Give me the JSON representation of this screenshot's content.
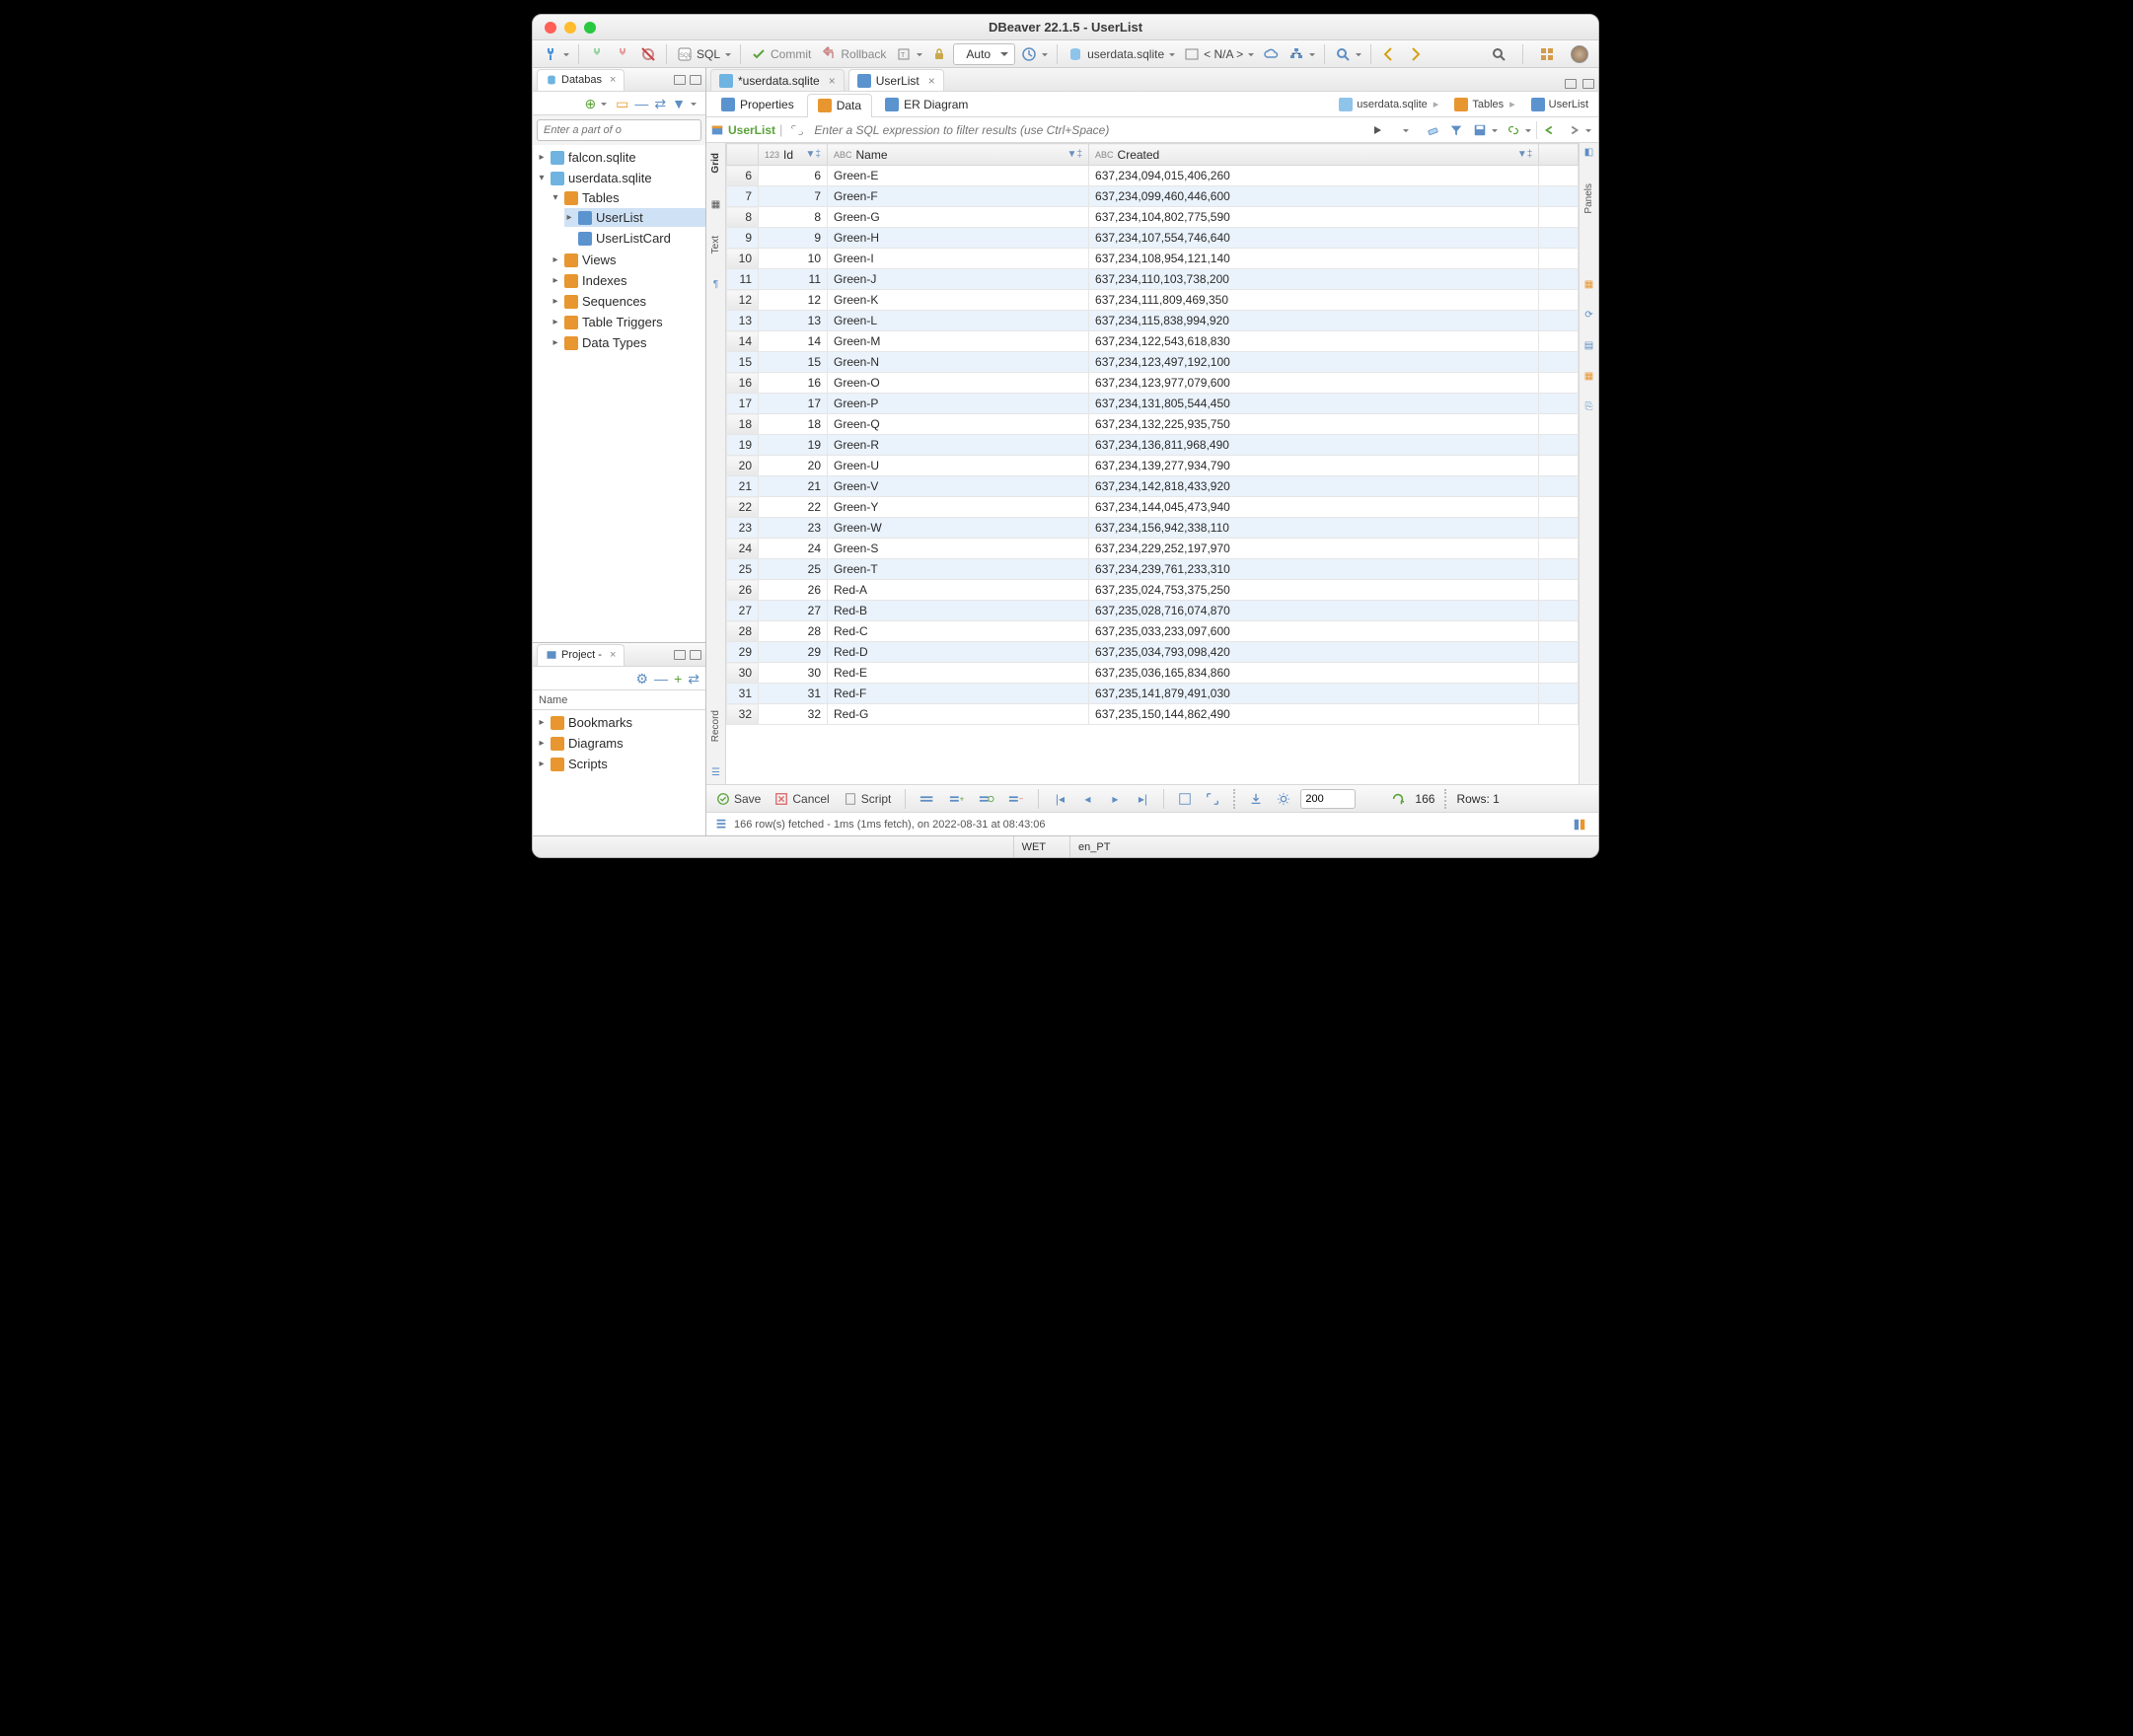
{
  "window": {
    "title": "DBeaver 22.1.5 - UserList"
  },
  "toolbar": {
    "sql_label": "SQL",
    "commit_label": "Commit",
    "rollback_label": "Rollback",
    "txn_mode": "Auto",
    "conn_crumb": "userdata.sqlite",
    "schema_crumb": "< N/A >"
  },
  "nav": {
    "panel_title": "Databas",
    "filter_placeholder": "Enter a part of o",
    "nodes": [
      {
        "label": "falcon.sqlite",
        "icon": "db",
        "expand": "closed"
      },
      {
        "label": "userdata.sqlite",
        "icon": "db",
        "expand": "open",
        "children": [
          {
            "label": "Tables",
            "icon": "folder-o",
            "expand": "open",
            "children": [
              {
                "label": "UserList",
                "icon": "table",
                "expand": "closed",
                "selected": true
              },
              {
                "label": "UserListCard",
                "icon": "table",
                "expand": "none"
              }
            ]
          },
          {
            "label": "Views",
            "icon": "folder",
            "expand": "closed"
          },
          {
            "label": "Indexes",
            "icon": "folder",
            "expand": "closed"
          },
          {
            "label": "Sequences",
            "icon": "folder",
            "expand": "closed"
          },
          {
            "label": "Table Triggers",
            "icon": "folder",
            "expand": "closed"
          },
          {
            "label": "Data Types",
            "icon": "folder",
            "expand": "closed"
          }
        ]
      }
    ]
  },
  "project": {
    "panel_title": "Project -",
    "header": "Name",
    "items": [
      {
        "label": "Bookmarks",
        "icon": "folder"
      },
      {
        "label": "Diagrams",
        "icon": "folder"
      },
      {
        "label": "Scripts",
        "icon": "folder"
      }
    ]
  },
  "editor_tabs": [
    {
      "label": "*userdata.sqlite",
      "icon": "db",
      "active": false,
      "dirty": true
    },
    {
      "label": "UserList",
      "icon": "table",
      "active": true,
      "dirty": false
    }
  ],
  "subtabs": [
    {
      "label": "Properties",
      "icon": "table",
      "active": false
    },
    {
      "label": "Data",
      "icon": "grid",
      "active": true
    },
    {
      "label": "ER Diagram",
      "icon": "diagram",
      "active": false
    }
  ],
  "breadcrumb": [
    {
      "label": "userdata.sqlite",
      "icon": "db"
    },
    {
      "label": "Tables",
      "icon": "folder-o"
    },
    {
      "label": "UserList",
      "icon": "table"
    }
  ],
  "data_filter": {
    "table_label": "UserList",
    "placeholder": "Enter a SQL expression to filter results (use Ctrl+Space)"
  },
  "vert_left": [
    "Grid",
    "Text",
    "Record"
  ],
  "vert_right_label": "Panels",
  "columns": [
    {
      "name": "Id",
      "type_prefix": "123"
    },
    {
      "name": "Name",
      "type_prefix": "ABC"
    },
    {
      "name": "Created",
      "type_prefix": "ABC"
    }
  ],
  "rows": [
    {
      "n": 6,
      "id": 6,
      "name": "Green-E",
      "created": "637,234,094,015,406,260"
    },
    {
      "n": 7,
      "id": 7,
      "name": "Green-F",
      "created": "637,234,099,460,446,600"
    },
    {
      "n": 8,
      "id": 8,
      "name": "Green-G",
      "created": "637,234,104,802,775,590"
    },
    {
      "n": 9,
      "id": 9,
      "name": "Green-H",
      "created": "637,234,107,554,746,640"
    },
    {
      "n": 10,
      "id": 10,
      "name": "Green-I",
      "created": "637,234,108,954,121,140"
    },
    {
      "n": 11,
      "id": 11,
      "name": "Green-J",
      "created": "637,234,110,103,738,200"
    },
    {
      "n": 12,
      "id": 12,
      "name": "Green-K",
      "created": "637,234,111,809,469,350"
    },
    {
      "n": 13,
      "id": 13,
      "name": "Green-L",
      "created": "637,234,115,838,994,920"
    },
    {
      "n": 14,
      "id": 14,
      "name": "Green-M",
      "created": "637,234,122,543,618,830"
    },
    {
      "n": 15,
      "id": 15,
      "name": "Green-N",
      "created": "637,234,123,497,192,100"
    },
    {
      "n": 16,
      "id": 16,
      "name": "Green-O",
      "created": "637,234,123,977,079,600"
    },
    {
      "n": 17,
      "id": 17,
      "name": "Green-P",
      "created": "637,234,131,805,544,450"
    },
    {
      "n": 18,
      "id": 18,
      "name": "Green-Q",
      "created": "637,234,132,225,935,750"
    },
    {
      "n": 19,
      "id": 19,
      "name": "Green-R",
      "created": "637,234,136,811,968,490"
    },
    {
      "n": 20,
      "id": 20,
      "name": "Green-U",
      "created": "637,234,139,277,934,790"
    },
    {
      "n": 21,
      "id": 21,
      "name": "Green-V",
      "created": "637,234,142,818,433,920"
    },
    {
      "n": 22,
      "id": 22,
      "name": "Green-Y",
      "created": "637,234,144,045,473,940"
    },
    {
      "n": 23,
      "id": 23,
      "name": "Green-W",
      "created": "637,234,156,942,338,110"
    },
    {
      "n": 24,
      "id": 24,
      "name": "Green-S",
      "created": "637,234,229,252,197,970"
    },
    {
      "n": 25,
      "id": 25,
      "name": "Green-T",
      "created": "637,234,239,761,233,310"
    },
    {
      "n": 26,
      "id": 26,
      "name": "Red-A",
      "created": "637,235,024,753,375,250"
    },
    {
      "n": 27,
      "id": 27,
      "name": "Red-B",
      "created": "637,235,028,716,074,870"
    },
    {
      "n": 28,
      "id": 28,
      "name": "Red-C",
      "created": "637,235,033,233,097,600"
    },
    {
      "n": 29,
      "id": 29,
      "name": "Red-D",
      "created": "637,235,034,793,098,420"
    },
    {
      "n": 30,
      "id": 30,
      "name": "Red-E",
      "created": "637,235,036,165,834,860"
    },
    {
      "n": 31,
      "id": 31,
      "name": "Red-F",
      "created": "637,235,141,879,491,030"
    },
    {
      "n": 32,
      "id": 32,
      "name": "Red-G",
      "created": "637,235,150,144,862,490"
    }
  ],
  "bottom": {
    "save": "Save",
    "cancel": "Cancel",
    "script": "Script",
    "page_size": "200",
    "row_count": "166",
    "rows_label": "Rows: 1"
  },
  "info_bar": "166 row(s) fetched - 1ms (1ms fetch), on 2022-08-31 at 08:43:06",
  "status": {
    "tz": "WET",
    "locale": "en_PT"
  }
}
